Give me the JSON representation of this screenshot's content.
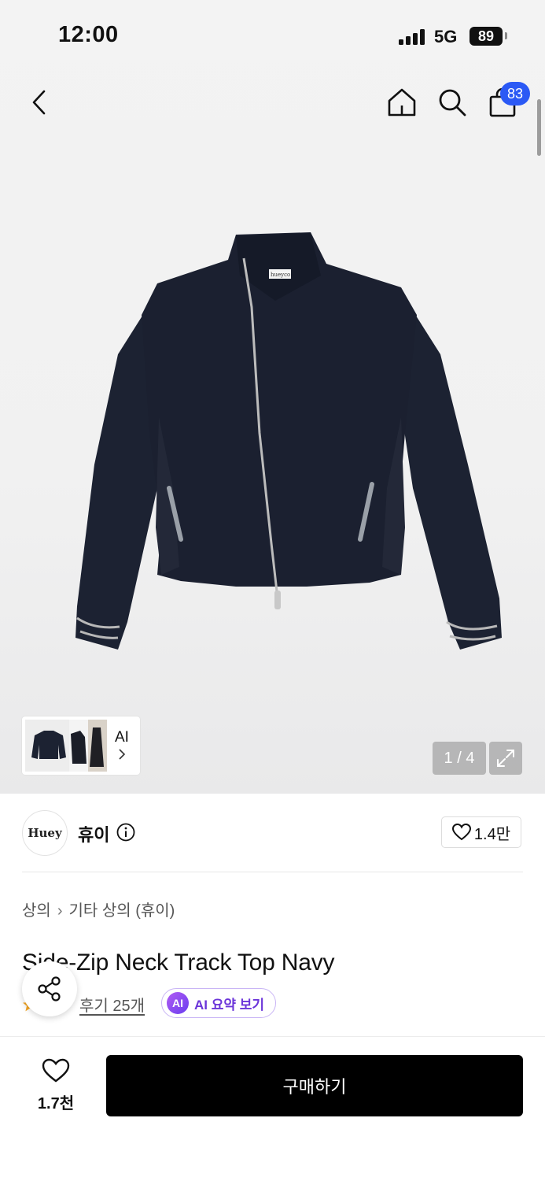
{
  "status_bar": {
    "time": "12:00",
    "network": "5G",
    "battery": "89"
  },
  "nav": {
    "cart_count": "83"
  },
  "gallery": {
    "thumb_ai_label": "AI",
    "page_counter": "1 / 4",
    "garment_label": "hueyco"
  },
  "brand": {
    "logo_text": "Huey",
    "name": "휴이",
    "likes": "1.4만"
  },
  "breadcrumb": {
    "level1": "상의",
    "level2": "기타 상의 (휴이)"
  },
  "product": {
    "title": "Side-Zip Neck Track Top Navy"
  },
  "reviews": {
    "link": "후기 25개",
    "ai_badge": "AI",
    "ai_summary_label": "AI 요약 보기"
  },
  "bottom_bar": {
    "wish_count": "1.7천",
    "buy_label": "구매하기"
  },
  "colors": {
    "accent_blue": "#2b59f5",
    "ai_purple": "#6b35d9",
    "buy_button": "#000000",
    "rating_star": "#f5a623"
  }
}
